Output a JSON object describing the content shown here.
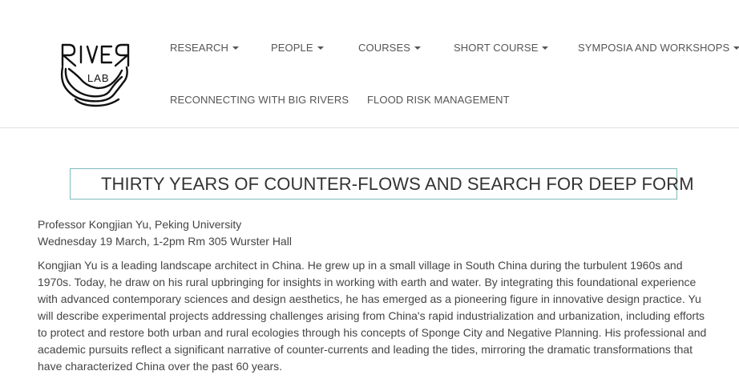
{
  "logo": {
    "text_line1": "RIVER",
    "text_line2": "LAB"
  },
  "nav": {
    "research": "RESEARCH",
    "people": "PEOPLE",
    "courses": "COURSES",
    "short_course": "SHORT COURSE",
    "symposia": "SYMPOSIA AND WORKSHOPS",
    "reconnecting": "RECONNECTING WITH BIG RIVERS",
    "flood": "FLOOD RISK MANAGEMENT"
  },
  "event": {
    "title": "THIRTY YEARS OF COUNTER-FLOWS AND SEARCH FOR DEEP FORM",
    "speaker": "Professor Kongjian Yu, Peking University",
    "datetime": "Wednesday 19 March, 1-2pm Rm 305 Wurster Hall",
    "description": "Kongjian Yu is a leading landscape architect in China. He grew up in a small village in South China during the turbulent 1960s and 1970s. Today, he draw on his rural upbringing for insights in working with earth and water. By integrating this foundational experience with advanced contemporary sciences and design aesthetics, he has emerged as a pioneering figure in innovative design practice. Yu will describe experimental projects addressing challenges arising from China's rapid industrialization and urbanization, including efforts to protect and restore both urban and rural ecologies through his concepts of Sponge City and Negative Planning. His professional and academic pursuits reflect a significant narrative of counter-currents and leading the tides, mirroring the dramatic transformations that have characterized China over the past 60 years."
  },
  "colors": {
    "title_border": "#7fbcbc",
    "text": "#444444",
    "nav": "#555555",
    "divider": "#e3e3e3"
  }
}
